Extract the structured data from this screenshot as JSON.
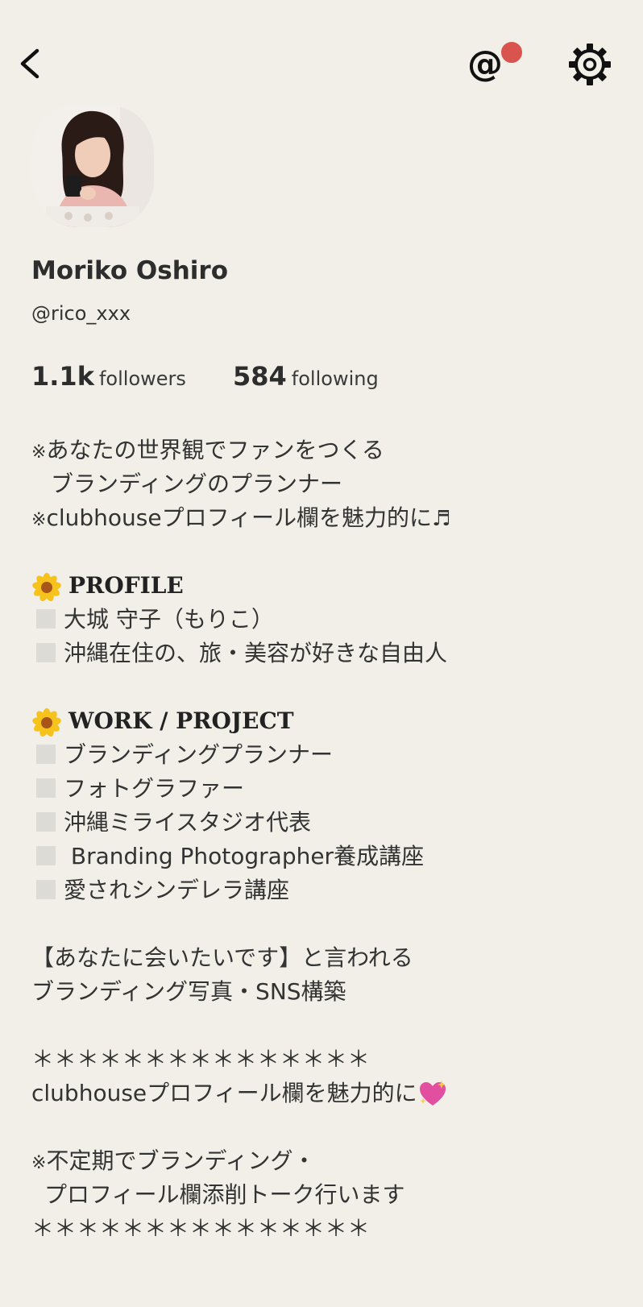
{
  "header": {
    "back_icon": "chevron-left-icon",
    "mention_icon": "at-icon",
    "mention_glyph": "@",
    "notification_color": "#d9534f",
    "settings_icon": "gear-icon"
  },
  "profile": {
    "name": "Moriko Oshiro",
    "handle": "@rico_xxx",
    "followers_count": "1.1k",
    "followers_label": "followers",
    "following_count": "584",
    "following_label": "following"
  },
  "bio": {
    "l1_mark": "※",
    "l1_text": "あなたの世界観でファンをつくる",
    "l2_text": "ブランディングのプランナー",
    "l3_mark": "※",
    "l3_text": "clubhouseプロフィール欄を魅力的に",
    "l3_music": "♬",
    "profile_heading": "PROFILE",
    "profile_items": [
      "大城 守子（もりこ）",
      "沖縄在住の、旅・美容が好きな自由人"
    ],
    "work_heading": "WORK / PROJECT",
    "work_items": [
      "ブランディングプランナー",
      "フォトグラファー",
      "沖縄ミライスタジオ代表",
      " Branding Photographer養成講座",
      "愛されシンデレラ講座"
    ],
    "p1": "【あなたに会いたいです】と言われる",
    "p2": "ブランディング写真・SNS構築",
    "stars": "＊＊＊＊＊＊＊＊＊＊＊＊＊＊＊",
    "p3": "clubhouseプロフィール欄を魅力的に",
    "p4_mark": "※",
    "p4_text": "不定期でブランディング・",
    "p5": "プロフィール欄添削トーク行います",
    "stars_end": "＊＊＊＊＊＊＊＊＊＊＊＊＊＊＊"
  }
}
